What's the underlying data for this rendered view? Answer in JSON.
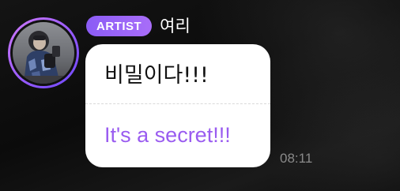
{
  "message": {
    "badge_label": "ARTIST",
    "sender_name": "여리",
    "original_text": "비밀이다!!!",
    "translated_text": "It's a secret!!!",
    "timestamp": "08:11"
  },
  "colors": {
    "badge_gradient_start": "#8b5cf6",
    "badge_gradient_end": "#a86df8",
    "translated_text": "#9a5cf0",
    "avatar_ring": "#9b5cff",
    "bubble_background": "#ffffff",
    "timestamp_text": "#8a8a8a"
  },
  "icons": {
    "avatar": "profile-photo"
  }
}
